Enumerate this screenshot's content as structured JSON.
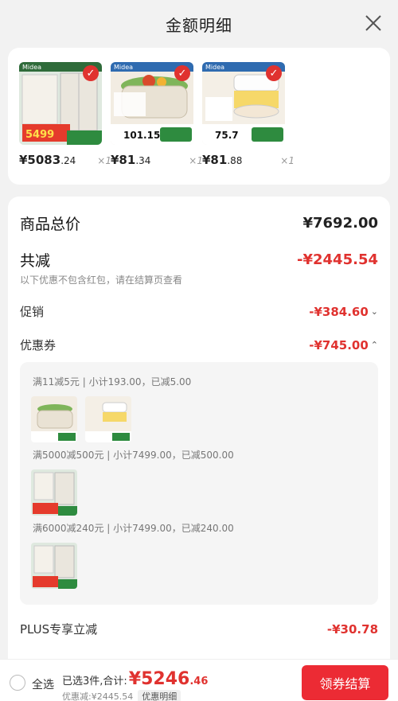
{
  "header": {
    "title": "金额明细"
  },
  "products": [
    {
      "brand": "Midea",
      "price_main": "¥5083",
      "price_dec": ".24",
      "qty": "×1",
      "badge": "5499"
    },
    {
      "brand": "Midea",
      "price_main": "¥81",
      "price_dec": ".34",
      "qty": "×1",
      "badge": "101.15"
    },
    {
      "brand": "Midea",
      "price_main": "¥81",
      "price_dec": ".88",
      "qty": "×1",
      "badge": "75.7"
    }
  ],
  "details": {
    "total_label": "商品总价",
    "total_value": "¥7692.00",
    "discount_label": "共减",
    "discount_value": "-¥2445.54",
    "discount_note": "以下优惠不包含红包，请在结算页查看",
    "promo_label": "促销",
    "promo_value": "-¥384.60",
    "coupon_label": "优惠券",
    "coupon_value": "-¥745.00",
    "coupons": [
      {
        "title": "满11减5元 | 小计193.00，已减5.00"
      },
      {
        "title": "满5000减500元 | 小计7499.00，已减500.00"
      },
      {
        "title": "满6000减240元 | 小计7499.00，已减240.00"
      }
    ],
    "plus_label": "PLUS专享立减",
    "plus_value": "-¥30.78"
  },
  "bottom": {
    "select_all": "全选",
    "selected_text": "已选3件,合计:",
    "total_main": "¥5246",
    "total_dec": ".46",
    "saved_text": "优惠减:¥2445.54",
    "detail_chip": "优惠明细",
    "checkout": "领券结算"
  },
  "colors": {
    "accent": "#e0322f",
    "checkout_bg": "#ec2b34"
  }
}
